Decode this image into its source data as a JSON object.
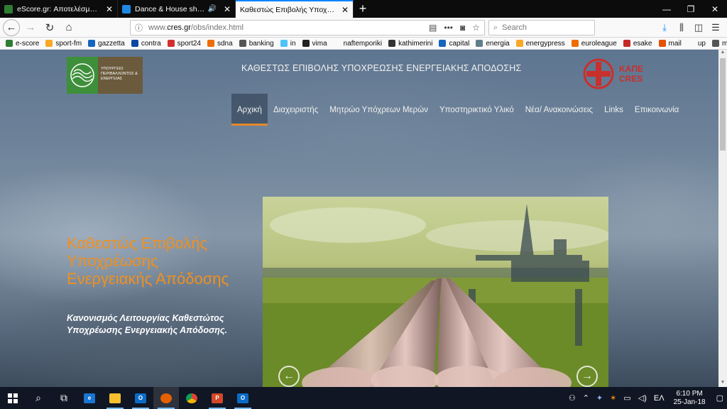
{
  "browser": {
    "tabs": [
      {
        "title": "eScore.gr: Αποτελέσματα αγώνων",
        "favicon_color": "#2e7d32",
        "active": false,
        "audio": false
      },
      {
        "title": "Dance & House shows | Mix",
        "favicon_color": "#1e88e5",
        "active": false,
        "audio": true
      },
      {
        "title": "Καθεστώς Επιβολής Υποχρέωσης",
        "favicon_color": "#ffffff",
        "active": true,
        "audio": false
      }
    ],
    "new_tab": "+",
    "url_prefix": "www.",
    "url_host": "cres.gr",
    "url_path": "/obs/index.html",
    "search_placeholder": "Search",
    "bookmarks": [
      {
        "label": "e-score",
        "color": "#2e7d32"
      },
      {
        "label": "sport-fm",
        "color": "#f9a825"
      },
      {
        "label": "gazzetta",
        "color": "#1565c0"
      },
      {
        "label": "contra",
        "color": "#0d47a1"
      },
      {
        "label": "sport24",
        "color": "#d32f2f"
      },
      {
        "label": "sdna",
        "color": "#ef6c00"
      },
      {
        "label": "banking",
        "color": "#555555"
      },
      {
        "label": "in",
        "color": "#4fc3f7"
      },
      {
        "label": "vima",
        "color": "#222222"
      },
      {
        "label": "naftemporiki",
        "color": "#f9f9fa"
      },
      {
        "label": "kathimerini",
        "color": "#333333"
      },
      {
        "label": "capital",
        "color": "#1565c0"
      },
      {
        "label": "energia",
        "color": "#607d8b"
      },
      {
        "label": "energypress",
        "color": "#f9a825"
      },
      {
        "label": "euroleague",
        "color": "#ef6c00"
      },
      {
        "label": "esake",
        "color": "#c62828"
      },
      {
        "label": "mail",
        "color": "#e65100"
      },
      {
        "label": "up",
        "color": "#f9f9fa"
      },
      {
        "label": "mix",
        "color": "#555555"
      }
    ]
  },
  "site": {
    "logo_left_text": "ΥΠΟΥΡΓΕΙΟ ΠΕΡΙΒΑΛΛΟΝΤΟΣ & ΕΝΕΡΓΕΙΑΣ",
    "header_title": "ΚΑΘΕΣΤΩΣ ΕΠΙΒΟΛΗΣ ΥΠΟΧΡΕΩΣΗΣ ΕΝΕΡΓΕΙΑΚΗΣ ΑΠΟΔΟΣΗΣ",
    "logo_right_line1": "ΚΑΠΕ",
    "logo_right_line2": "CRES",
    "menu": [
      "Αρχική",
      "Διαχειριστής",
      "Μητρώο Υπόχρεων Μερών",
      "Υποστηρικτικό Υλικό",
      "Νέα/ Ανακοινώσεις",
      "Links",
      "Επικοινωνία"
    ],
    "hero_title": "Καθεστώς Επιβολής Υποχρέωσης Ενεργειακής Απόδοσης",
    "hero_subtitle": "Κανονισμός Λειτουργίας Καθεστώτος Υποχρέωσης Ενεργειακής Απόδοσης."
  },
  "taskbar": {
    "time": "6:10 PM",
    "date": "25-Jan-18",
    "language": "ΕΛ"
  },
  "colors": {
    "accent_orange": "#f0901e",
    "menu_underline": "#e48a2a",
    "firefox_blue": "#0a84ff"
  }
}
